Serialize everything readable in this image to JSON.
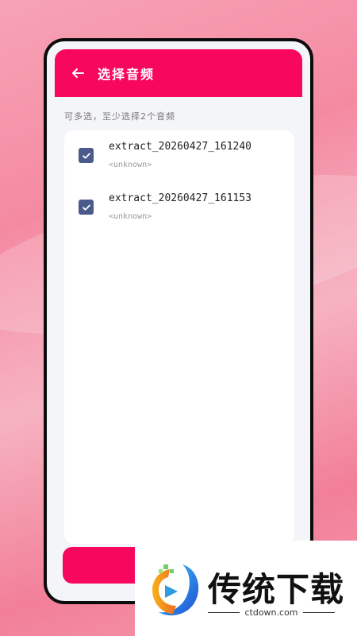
{
  "header": {
    "title": "选择音频",
    "back_icon": "arrow-left-icon"
  },
  "hint": "可多选，至少选择2个音频",
  "audio_list": [
    {
      "name": "extract_20260427_161240",
      "artist": "<unknown>",
      "checked": true
    },
    {
      "name": "extract_20260427_161153",
      "artist": "<unknown>",
      "checked": true
    }
  ],
  "watermark": {
    "brand": "传统下载",
    "url": "ctdown.com"
  },
  "colors": {
    "accent": "#f8075f",
    "checkbox": "#4a5a8a",
    "background_pink": "#f48aa2"
  }
}
